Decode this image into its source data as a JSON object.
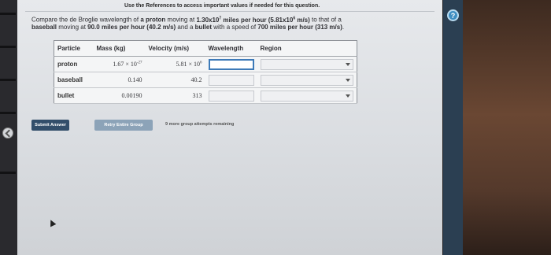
{
  "references_note": "Use the References to access important values if needed for this question.",
  "question": {
    "line1_prefix": "Compare the de Broglie wavelength of ",
    "line1_bold_a": "a proton",
    "line1_mid": " moving at ",
    "line1_bold_b": "1.30x10",
    "line1_bold_b_exp": "7",
    "line1_bold_c": " miles per hour",
    "line1_bold_d": " (5.81x10",
    "line1_bold_d_exp": "6",
    "line1_bold_e": " m/s)",
    "line1_suffix": " to that of a",
    "line2_bold_a": "baseball",
    "line2_mid_a": " moving at ",
    "line2_bold_b": "90.0 miles per hour (40.2 m/s)",
    "line2_mid_b": " and a ",
    "line2_bold_c": "bullet",
    "line2_mid_c": " with a speed of ",
    "line2_bold_d": "700 miles per hour (313 m/s)",
    "line2_suffix": "."
  },
  "table": {
    "headers": {
      "particle": "Particle",
      "mass": "Mass (kg)",
      "velocity": "Velocity (m/s)",
      "wavelength": "Wavelength",
      "region": "Region"
    },
    "rows": [
      {
        "particle": "proton",
        "mass": "1.67 × 10",
        "mass_exp": "-27",
        "velocity": "5.81 × 10",
        "velocity_exp": "6",
        "wavelength": "",
        "region": ""
      },
      {
        "particle": "baseball",
        "mass": "0.140",
        "mass_exp": "",
        "velocity": "40.2",
        "velocity_exp": "",
        "wavelength": "",
        "region": ""
      },
      {
        "particle": "bullet",
        "mass": "0.00190",
        "mass_exp": "",
        "velocity": "313",
        "velocity_exp": "",
        "wavelength": "",
        "region": ""
      }
    ]
  },
  "buttons": {
    "submit": "Submit Answer",
    "retry": "Retry Entire Group"
  },
  "attempts_text": "9 more group attempts remaining",
  "sidebar": {
    "help_icon": "question-circle-icon",
    "help_glyph": "?"
  },
  "colors": {
    "submit": "#324e6a",
    "retry": "#8ca3b8",
    "help": "#3f8ec2"
  }
}
